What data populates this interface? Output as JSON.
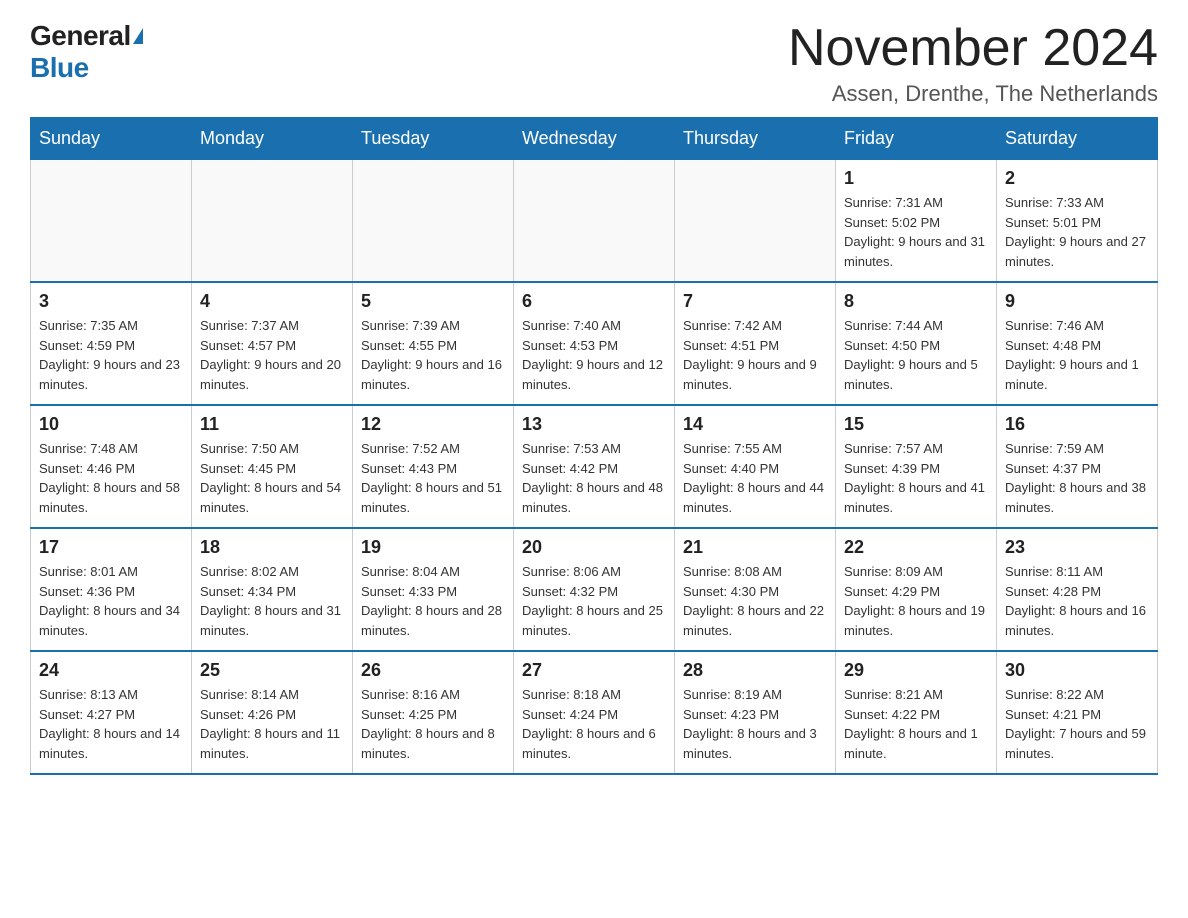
{
  "header": {
    "logo_general": "General",
    "logo_blue": "Blue",
    "title": "November 2024",
    "subtitle": "Assen, Drenthe, The Netherlands"
  },
  "days_of_week": [
    "Sunday",
    "Monday",
    "Tuesday",
    "Wednesday",
    "Thursday",
    "Friday",
    "Saturday"
  ],
  "weeks": [
    [
      {
        "day": "",
        "sunrise": "",
        "sunset": "",
        "daylight": ""
      },
      {
        "day": "",
        "sunrise": "",
        "sunset": "",
        "daylight": ""
      },
      {
        "day": "",
        "sunrise": "",
        "sunset": "",
        "daylight": ""
      },
      {
        "day": "",
        "sunrise": "",
        "sunset": "",
        "daylight": ""
      },
      {
        "day": "",
        "sunrise": "",
        "sunset": "",
        "daylight": ""
      },
      {
        "day": "1",
        "sunrise": "Sunrise: 7:31 AM",
        "sunset": "Sunset: 5:02 PM",
        "daylight": "Daylight: 9 hours and 31 minutes."
      },
      {
        "day": "2",
        "sunrise": "Sunrise: 7:33 AM",
        "sunset": "Sunset: 5:01 PM",
        "daylight": "Daylight: 9 hours and 27 minutes."
      }
    ],
    [
      {
        "day": "3",
        "sunrise": "Sunrise: 7:35 AM",
        "sunset": "Sunset: 4:59 PM",
        "daylight": "Daylight: 9 hours and 23 minutes."
      },
      {
        "day": "4",
        "sunrise": "Sunrise: 7:37 AM",
        "sunset": "Sunset: 4:57 PM",
        "daylight": "Daylight: 9 hours and 20 minutes."
      },
      {
        "day": "5",
        "sunrise": "Sunrise: 7:39 AM",
        "sunset": "Sunset: 4:55 PM",
        "daylight": "Daylight: 9 hours and 16 minutes."
      },
      {
        "day": "6",
        "sunrise": "Sunrise: 7:40 AM",
        "sunset": "Sunset: 4:53 PM",
        "daylight": "Daylight: 9 hours and 12 minutes."
      },
      {
        "day": "7",
        "sunrise": "Sunrise: 7:42 AM",
        "sunset": "Sunset: 4:51 PM",
        "daylight": "Daylight: 9 hours and 9 minutes."
      },
      {
        "day": "8",
        "sunrise": "Sunrise: 7:44 AM",
        "sunset": "Sunset: 4:50 PM",
        "daylight": "Daylight: 9 hours and 5 minutes."
      },
      {
        "day": "9",
        "sunrise": "Sunrise: 7:46 AM",
        "sunset": "Sunset: 4:48 PM",
        "daylight": "Daylight: 9 hours and 1 minute."
      }
    ],
    [
      {
        "day": "10",
        "sunrise": "Sunrise: 7:48 AM",
        "sunset": "Sunset: 4:46 PM",
        "daylight": "Daylight: 8 hours and 58 minutes."
      },
      {
        "day": "11",
        "sunrise": "Sunrise: 7:50 AM",
        "sunset": "Sunset: 4:45 PM",
        "daylight": "Daylight: 8 hours and 54 minutes."
      },
      {
        "day": "12",
        "sunrise": "Sunrise: 7:52 AM",
        "sunset": "Sunset: 4:43 PM",
        "daylight": "Daylight: 8 hours and 51 minutes."
      },
      {
        "day": "13",
        "sunrise": "Sunrise: 7:53 AM",
        "sunset": "Sunset: 4:42 PM",
        "daylight": "Daylight: 8 hours and 48 minutes."
      },
      {
        "day": "14",
        "sunrise": "Sunrise: 7:55 AM",
        "sunset": "Sunset: 4:40 PM",
        "daylight": "Daylight: 8 hours and 44 minutes."
      },
      {
        "day": "15",
        "sunrise": "Sunrise: 7:57 AM",
        "sunset": "Sunset: 4:39 PM",
        "daylight": "Daylight: 8 hours and 41 minutes."
      },
      {
        "day": "16",
        "sunrise": "Sunrise: 7:59 AM",
        "sunset": "Sunset: 4:37 PM",
        "daylight": "Daylight: 8 hours and 38 minutes."
      }
    ],
    [
      {
        "day": "17",
        "sunrise": "Sunrise: 8:01 AM",
        "sunset": "Sunset: 4:36 PM",
        "daylight": "Daylight: 8 hours and 34 minutes."
      },
      {
        "day": "18",
        "sunrise": "Sunrise: 8:02 AM",
        "sunset": "Sunset: 4:34 PM",
        "daylight": "Daylight: 8 hours and 31 minutes."
      },
      {
        "day": "19",
        "sunrise": "Sunrise: 8:04 AM",
        "sunset": "Sunset: 4:33 PM",
        "daylight": "Daylight: 8 hours and 28 minutes."
      },
      {
        "day": "20",
        "sunrise": "Sunrise: 8:06 AM",
        "sunset": "Sunset: 4:32 PM",
        "daylight": "Daylight: 8 hours and 25 minutes."
      },
      {
        "day": "21",
        "sunrise": "Sunrise: 8:08 AM",
        "sunset": "Sunset: 4:30 PM",
        "daylight": "Daylight: 8 hours and 22 minutes."
      },
      {
        "day": "22",
        "sunrise": "Sunrise: 8:09 AM",
        "sunset": "Sunset: 4:29 PM",
        "daylight": "Daylight: 8 hours and 19 minutes."
      },
      {
        "day": "23",
        "sunrise": "Sunrise: 8:11 AM",
        "sunset": "Sunset: 4:28 PM",
        "daylight": "Daylight: 8 hours and 16 minutes."
      }
    ],
    [
      {
        "day": "24",
        "sunrise": "Sunrise: 8:13 AM",
        "sunset": "Sunset: 4:27 PM",
        "daylight": "Daylight: 8 hours and 14 minutes."
      },
      {
        "day": "25",
        "sunrise": "Sunrise: 8:14 AM",
        "sunset": "Sunset: 4:26 PM",
        "daylight": "Daylight: 8 hours and 11 minutes."
      },
      {
        "day": "26",
        "sunrise": "Sunrise: 8:16 AM",
        "sunset": "Sunset: 4:25 PM",
        "daylight": "Daylight: 8 hours and 8 minutes."
      },
      {
        "day": "27",
        "sunrise": "Sunrise: 8:18 AM",
        "sunset": "Sunset: 4:24 PM",
        "daylight": "Daylight: 8 hours and 6 minutes."
      },
      {
        "day": "28",
        "sunrise": "Sunrise: 8:19 AM",
        "sunset": "Sunset: 4:23 PM",
        "daylight": "Daylight: 8 hours and 3 minutes."
      },
      {
        "day": "29",
        "sunrise": "Sunrise: 8:21 AM",
        "sunset": "Sunset: 4:22 PM",
        "daylight": "Daylight: 8 hours and 1 minute."
      },
      {
        "day": "30",
        "sunrise": "Sunrise: 8:22 AM",
        "sunset": "Sunset: 4:21 PM",
        "daylight": "Daylight: 7 hours and 59 minutes."
      }
    ]
  ]
}
